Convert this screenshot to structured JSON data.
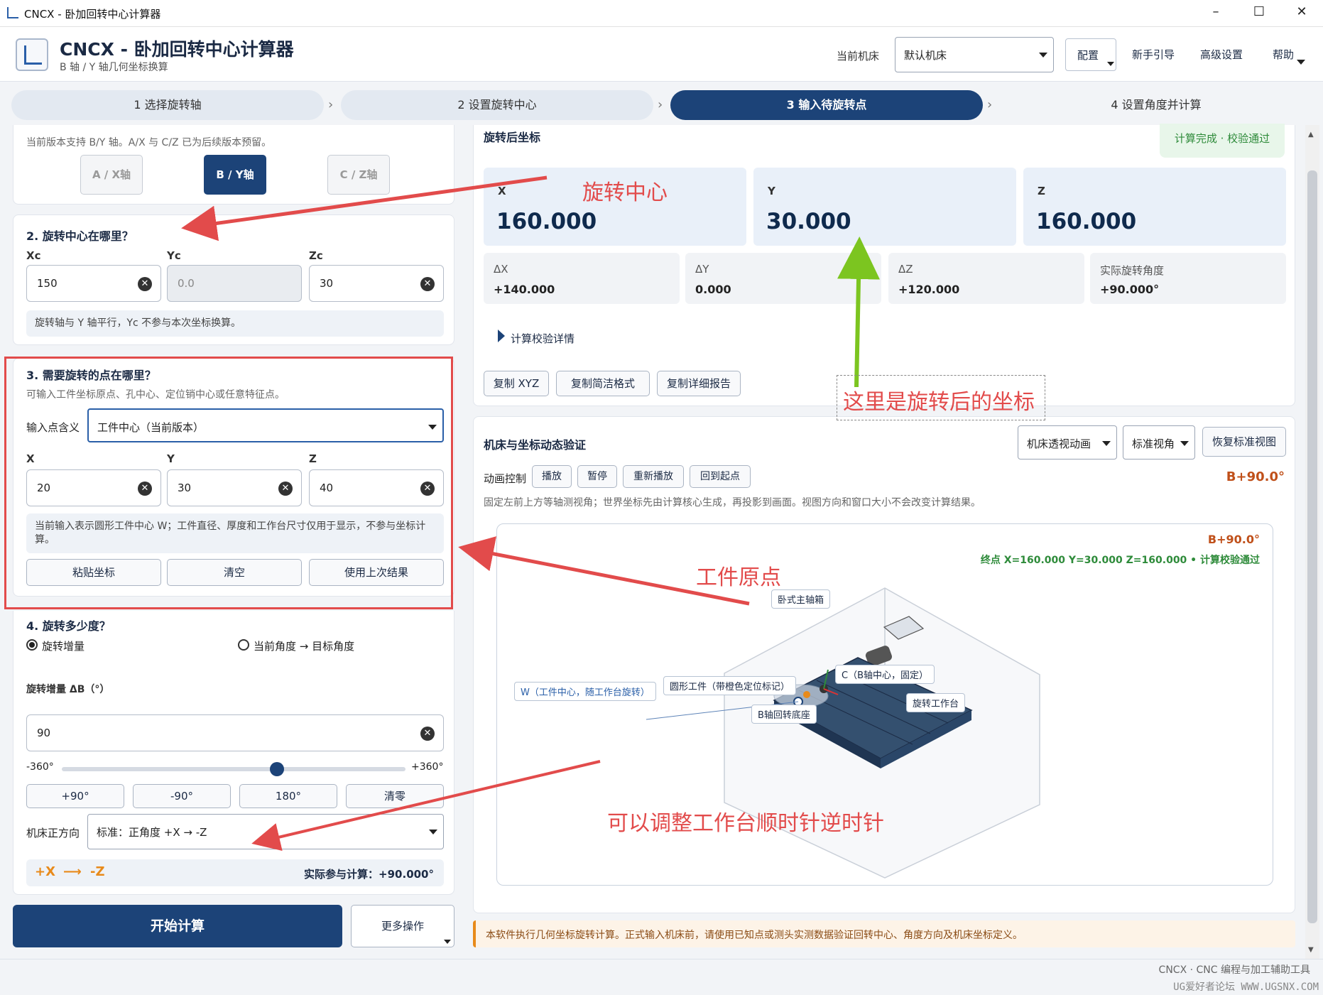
{
  "window": {
    "title": "CNCX - 卧加回转中心计算器",
    "min": "–",
    "max": "☐",
    "close": "✕"
  },
  "header": {
    "title": "CNCX - 卧加回转中心计算器",
    "subtitle": "B 轴 / Y 轴几何坐标换算",
    "machine_label": "当前机床",
    "machine_value": "默认机床",
    "config_button": "配置",
    "guide_link": "新手引导",
    "advanced_link": "高级设置",
    "help_link": "帮助"
  },
  "steps": [
    {
      "label": "1 选择旋转轴"
    },
    {
      "label": "2 设置旋转中心"
    },
    {
      "label": "3 输入待旋转点"
    },
    {
      "label": "4 设置角度并计算"
    }
  ],
  "left": {
    "axis_note": "当前版本支持 B/Y 轴。A/X 与 C/Z 已为后续版本预留。",
    "axis_buttons": [
      "A / X轴",
      "B / Y轴",
      "C / Z轴"
    ],
    "s2": {
      "title": "2. 旋转中心在哪里？",
      "labels": [
        "Xc",
        "Yc",
        "Zc"
      ],
      "values": [
        "150",
        "0.0",
        "30"
      ],
      "note": "旋转轴与 Y 轴平行，Yc 不参与本次坐标换算。"
    },
    "s3": {
      "title": "3. 需要旋转的点在哪里？",
      "hint": "可输入工件坐标原点、孔中心、定位销中心或任意特征点。",
      "meaning_label": "输入点含义",
      "meaning_value": "工件中心（当前版本）",
      "labels": [
        "X",
        "Y",
        "Z"
      ],
      "values": [
        "20",
        "30",
        "40"
      ],
      "note": "当前输入表示圆形工件中心 W；工件直径、厚度和工作台尺寸仅用于显示，不参与坐标计算。",
      "buttons": [
        "粘贴坐标",
        "清空",
        "使用上次结果"
      ]
    },
    "s4": {
      "title": "4. 旋转多少度？",
      "radio1": "旋转增量",
      "radio2": "当前角度 → 目标角度",
      "delta_label": "旋转增量 ΔB（°）",
      "delta_value": "90",
      "slider_min": "-360°",
      "slider_max": "+360°",
      "slider_value": 90,
      "quick": [
        "+90°",
        "-90°",
        "180°",
        "清零"
      ],
      "dir_label": "机床正方向",
      "dir_value": "标准：正角度 +X → -Z",
      "dir_from": "+X",
      "dir_arrow": "⟶",
      "dir_to": "-Z",
      "actual": "实际参与计算：+90.000°"
    },
    "start_button": "开始计算",
    "more_button": "更多操作"
  },
  "result": {
    "title": "旋转后坐标",
    "status": "计算完成 · 校验通过",
    "coords": [
      {
        "label": "X",
        "value": "160.000"
      },
      {
        "label": "Y",
        "value": "30.000"
      },
      {
        "label": "Z",
        "value": "160.000"
      }
    ],
    "deltas": [
      {
        "label": "ΔX",
        "value": "+140.000"
      },
      {
        "label": "ΔY",
        "value": "0.000"
      },
      {
        "label": "ΔZ",
        "value": "+120.000"
      },
      {
        "label": "实际旋转角度",
        "value": "+90.000°"
      }
    ],
    "details": "计算校验详情",
    "copy_buttons": [
      "复制 XYZ",
      "复制简洁格式",
      "复制详细报告"
    ]
  },
  "viz": {
    "title": "机床与坐标动态验证",
    "view_select": "机床透视动画",
    "angle_select": "标准视角",
    "reset_button": "恢复标准视图",
    "anim_label": "动画控制",
    "anim_buttons": [
      "播放",
      "暂停",
      "重新播放",
      "回到起点"
    ],
    "b_value": "B+90.0°",
    "desc": "固定左前上方等轴测视角；世界坐标先由计算核心生成，再投影到画面。视图方向和窗口大小不会改变计算结果。",
    "canvas_b": "B+90.0°",
    "canvas_status": "终点 X=160.000  Y=30.000  Z=160.000 • 计算校验通过",
    "labels": {
      "spindle": "卧式主轴箱",
      "w": "W（工件中心，随工作台旋转）",
      "work": "圆形工件（带橙色定位标记）",
      "c": "C（B轴中心，固定）",
      "base": "B轴回转底座",
      "table": "旋转工作台"
    }
  },
  "warning": "本软件执行几何坐标旋转计算。正式输入机床前，请使用已知点或测头实测数据验证回转中心、角度方向及机床坐标定义。",
  "footer": "CNCX · CNC 编程与加工辅助工具",
  "watermark": "UG爱好者论坛 WWW.UGSNX.COM",
  "annotations": {
    "a1": "旋转中心",
    "a2": "这里是旋转后的坐标",
    "a3": "工件原点",
    "a4": "可以调整工作台顺时针逆时针"
  },
  "colors": {
    "accent": "#1c4378",
    "annot": "#e24b4b",
    "green": "#7cc520",
    "ok": "#2e8b3a"
  }
}
